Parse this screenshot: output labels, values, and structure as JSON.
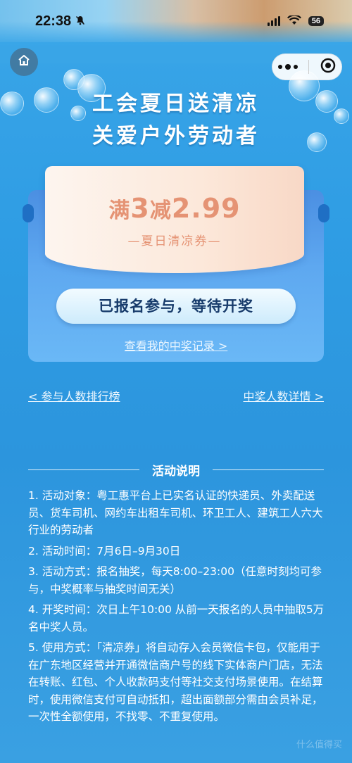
{
  "status_bar": {
    "time": "22:38",
    "battery": "56"
  },
  "header": {
    "title_line1": "工会夏日送清凉",
    "title_line2": "关爱户外劳动者"
  },
  "coupon": {
    "amount_prefix": "满",
    "amount_threshold": "3",
    "amount_mid": "减",
    "amount_value": "2.99",
    "name": "—夏日清凉券—"
  },
  "status_button": "已报名参与，等待开奖",
  "record_link": "查看我的中奖记录 >",
  "links": {
    "left": "< 参与人数排行榜",
    "right": "中奖人数详情 >"
  },
  "rules": {
    "title": "活动说明",
    "items": [
      "1. 活动对象：粤工惠平台上已实名认证的快递员、外卖配送员、货车司机、网约车出租车司机、环卫工人、建筑工人六大行业的劳动者",
      "2. 活动时间：7月6日–9月30日",
      "3. 活动方式：报名抽奖，每天8:00–23:00（任意时刻均可参与，中奖概率与抽奖时间无关）",
      "4. 开奖时间：次日上午10:00 从前一天报名的人员中抽取5万名中奖人员。",
      "5. 使用方式：「清凉券」将自动存入会员微信卡包，仅能用于在广东地区经营并开通微信商户号的线下实体商户门店，无法在转账、红包、个人收款码支付等社交支付场景使用。在结算时，使用微信支付可自动抵扣，超出面额部分需由会员补足，一次性全额使用，不找零、不重复使用。"
    ]
  },
  "watermark": "什么值得买",
  "colors": {
    "background": "#2f9de4",
    "coupon_text": "#e59374",
    "button_text": "#173b6b"
  }
}
